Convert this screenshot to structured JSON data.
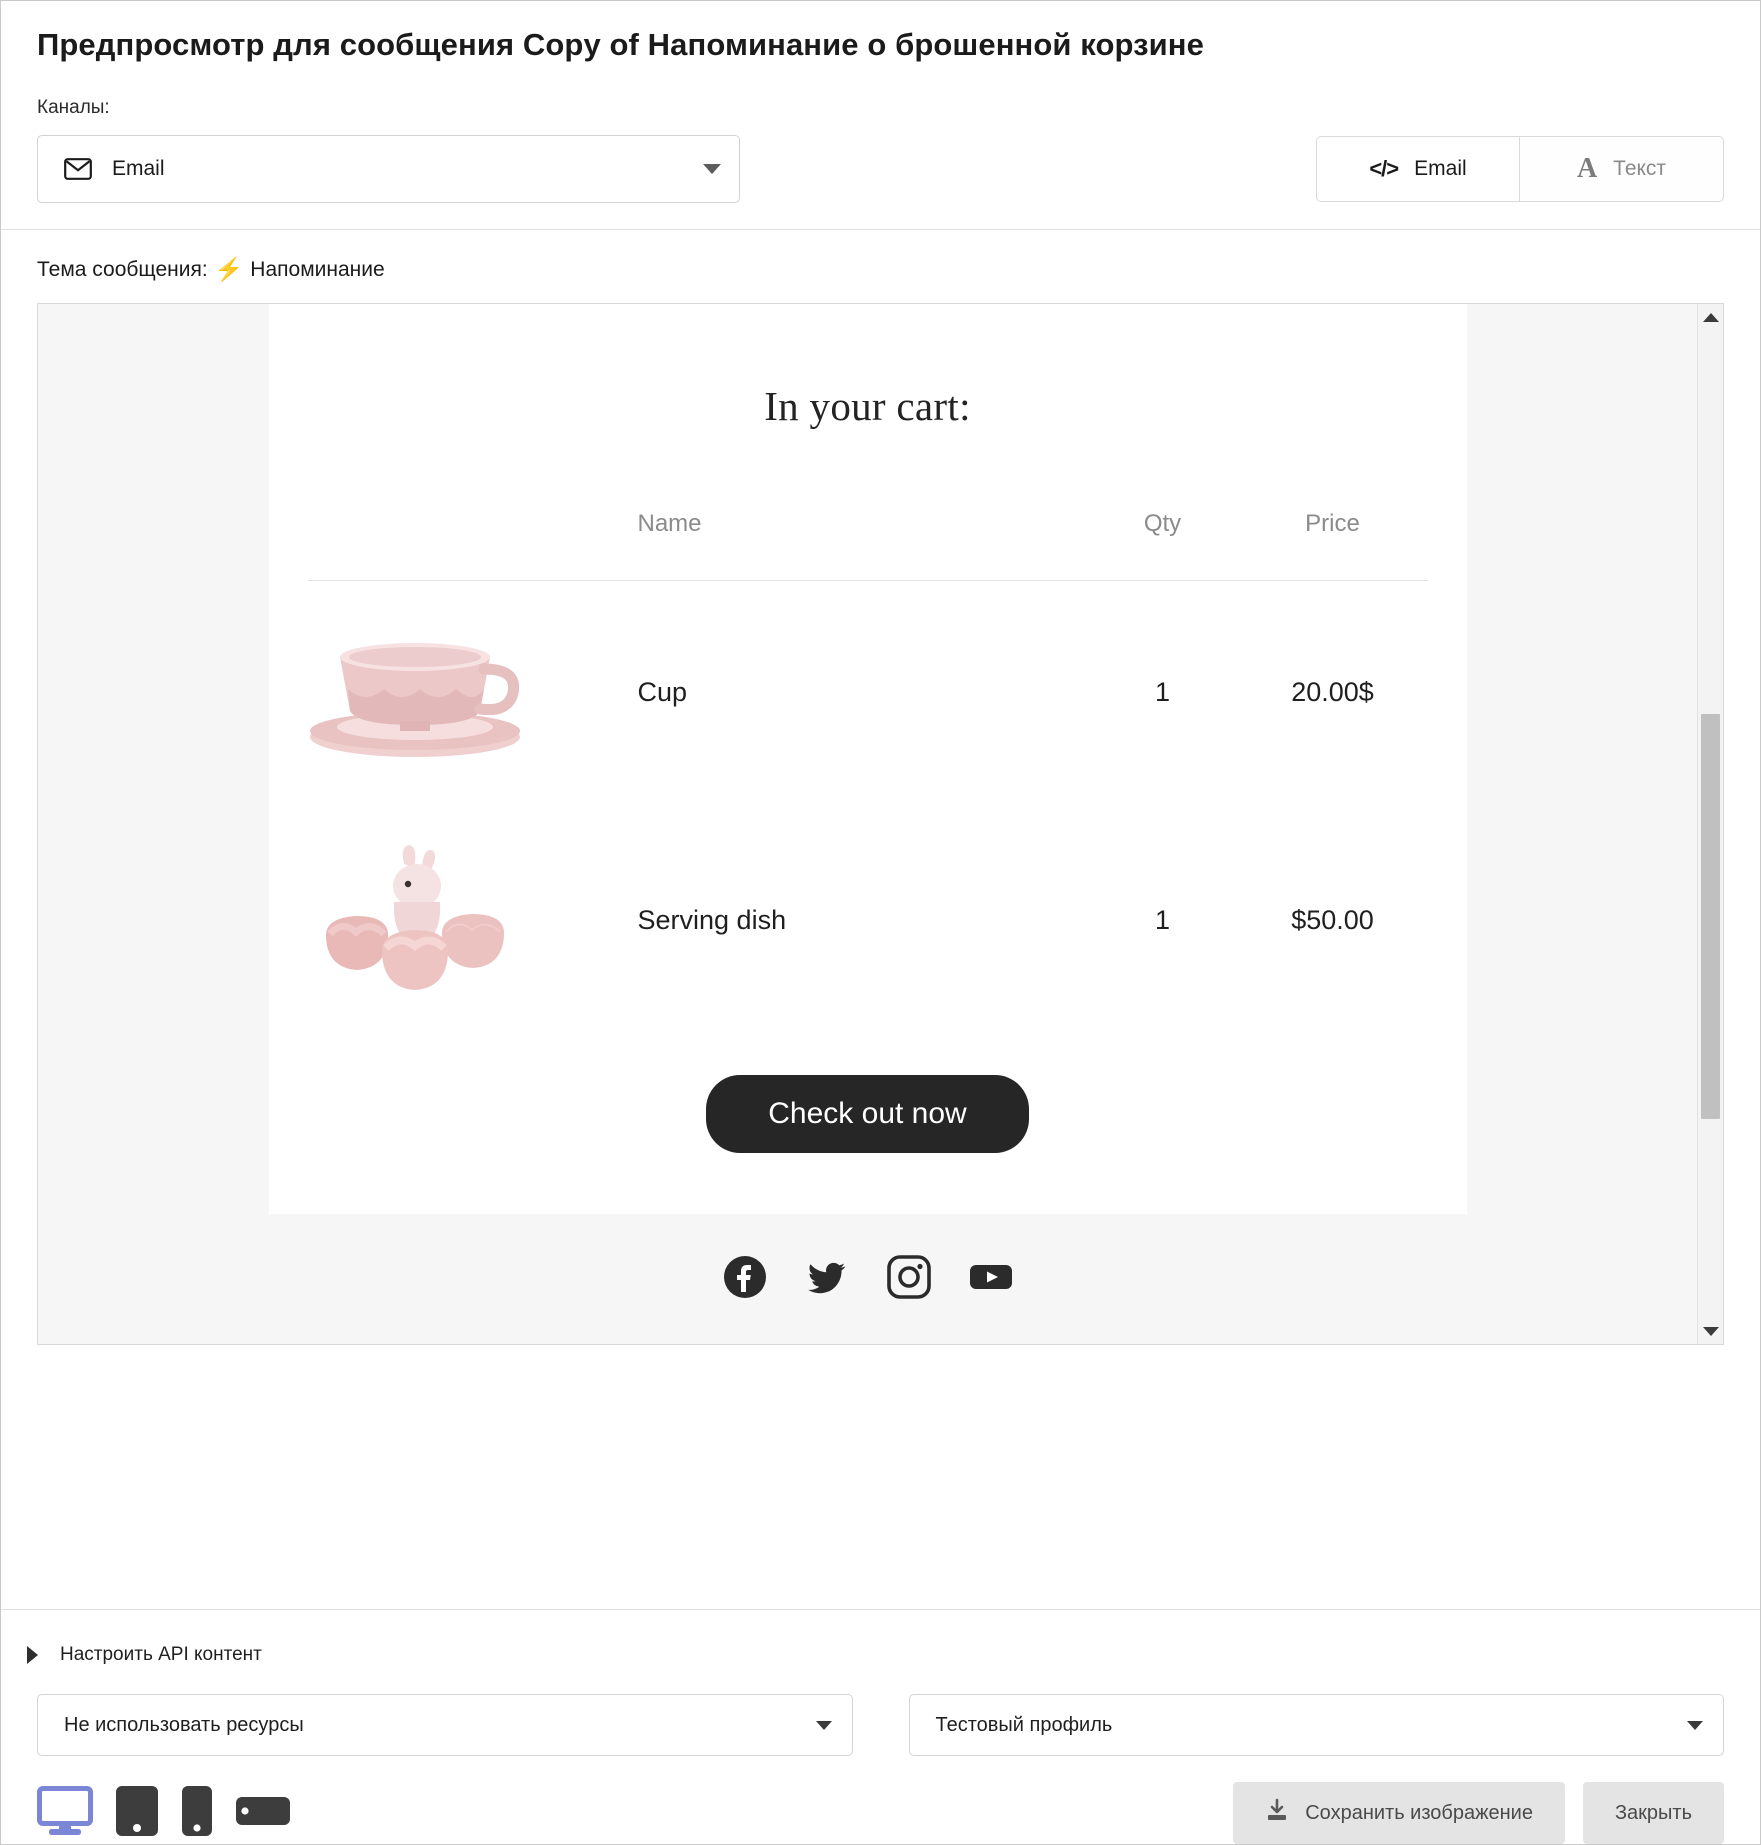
{
  "modal": {
    "title": "Предпросмотр для сообщения Copy of Напоминание о брошенной корзине"
  },
  "channels": {
    "label": "Каналы:",
    "selected": "Email",
    "icon": "mail-icon",
    "options": [
      "Email"
    ]
  },
  "view_toggle": {
    "html_label": "Email",
    "html_icon": "code-icon",
    "text_label": "Текст",
    "text_icon": "letter-a-icon",
    "active": "Email"
  },
  "subject": {
    "label": "Тема сообщения:",
    "bolt": "⚡",
    "value": "Напоминание"
  },
  "email_preview": {
    "heading": "In your cart:",
    "columns": {
      "image": "",
      "name": "Name",
      "qty": "Qty",
      "price": "Price"
    },
    "items": [
      {
        "image": "pink-teacup-image",
        "name": "Cup",
        "qty": "1",
        "price": "20.00$"
      },
      {
        "image": "pink-bunny-serving-dish-image",
        "name": "Serving dish",
        "qty": "1",
        "price": "$50.00"
      }
    ],
    "cta_label": "Check out now",
    "social": [
      {
        "name": "facebook-icon"
      },
      {
        "name": "twitter-icon"
      },
      {
        "name": "instagram-icon"
      },
      {
        "name": "youtube-icon"
      }
    ]
  },
  "api_section": {
    "toggle_label": "Настроить API контент",
    "resource_select": "Не использовать ресурсы",
    "profile_select": "Тестовый профиль"
  },
  "devices": [
    {
      "name": "desktop",
      "active": true
    },
    {
      "name": "tablet-portrait",
      "active": false
    },
    {
      "name": "mobile-portrait",
      "active": false
    },
    {
      "name": "mobile-landscape",
      "active": false
    }
  ],
  "footer": {
    "save_label": "Сохранить изображение",
    "save_icon": "download-icon",
    "close_label": "Закрыть"
  },
  "colors": {
    "accent": "#7b86d6",
    "cta_bg": "#262626",
    "bolt": "#f5c733",
    "product_pink": "#e8bdbd"
  }
}
